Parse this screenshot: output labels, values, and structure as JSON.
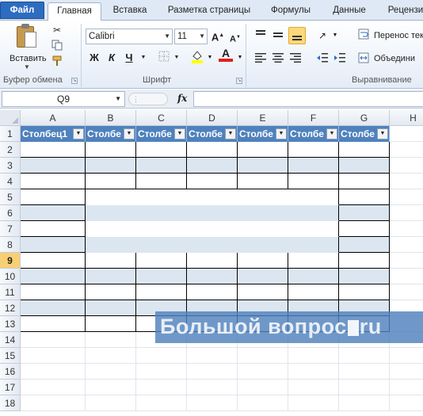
{
  "ribbon_tabs": [
    "Файл",
    "Главная",
    "Вставка",
    "Разметка страницы",
    "Формулы",
    "Данные",
    "Рецензи"
  ],
  "clipboard": {
    "paste_label": "Вставить",
    "group_label": "Буфер обмена"
  },
  "font": {
    "name": "Calibri",
    "size": "11",
    "group_label": "Шрифт",
    "bold": "Ж",
    "italic": "К",
    "underline": "Ч"
  },
  "alignment": {
    "wrap_text": "Перенос тек",
    "merge": "Объедини",
    "group_label": "Выравнивание"
  },
  "formula_bar": {
    "name_box": "Q9",
    "fx": "fx",
    "formula": ""
  },
  "columns": [
    "A",
    "B",
    "C",
    "D",
    "E",
    "F",
    "G",
    "H"
  ],
  "rows": [
    "1",
    "2",
    "3",
    "4",
    "5",
    "6",
    "7",
    "8",
    "9",
    "10",
    "11",
    "12",
    "13",
    "14",
    "15",
    "16",
    "17",
    "18"
  ],
  "selected_row": "9",
  "table_headers": [
    "Столбец1",
    "Столбе",
    "Столбе",
    "Столбе",
    "Столбе",
    "Столбе",
    "Столбе"
  ],
  "watermark": {
    "part1": "Большой вопрос",
    "part2": "ru"
  },
  "colors": {
    "table_header": "#4f81bd",
    "band": "#dce6f1",
    "selected_row_header": "#f8cf73"
  }
}
